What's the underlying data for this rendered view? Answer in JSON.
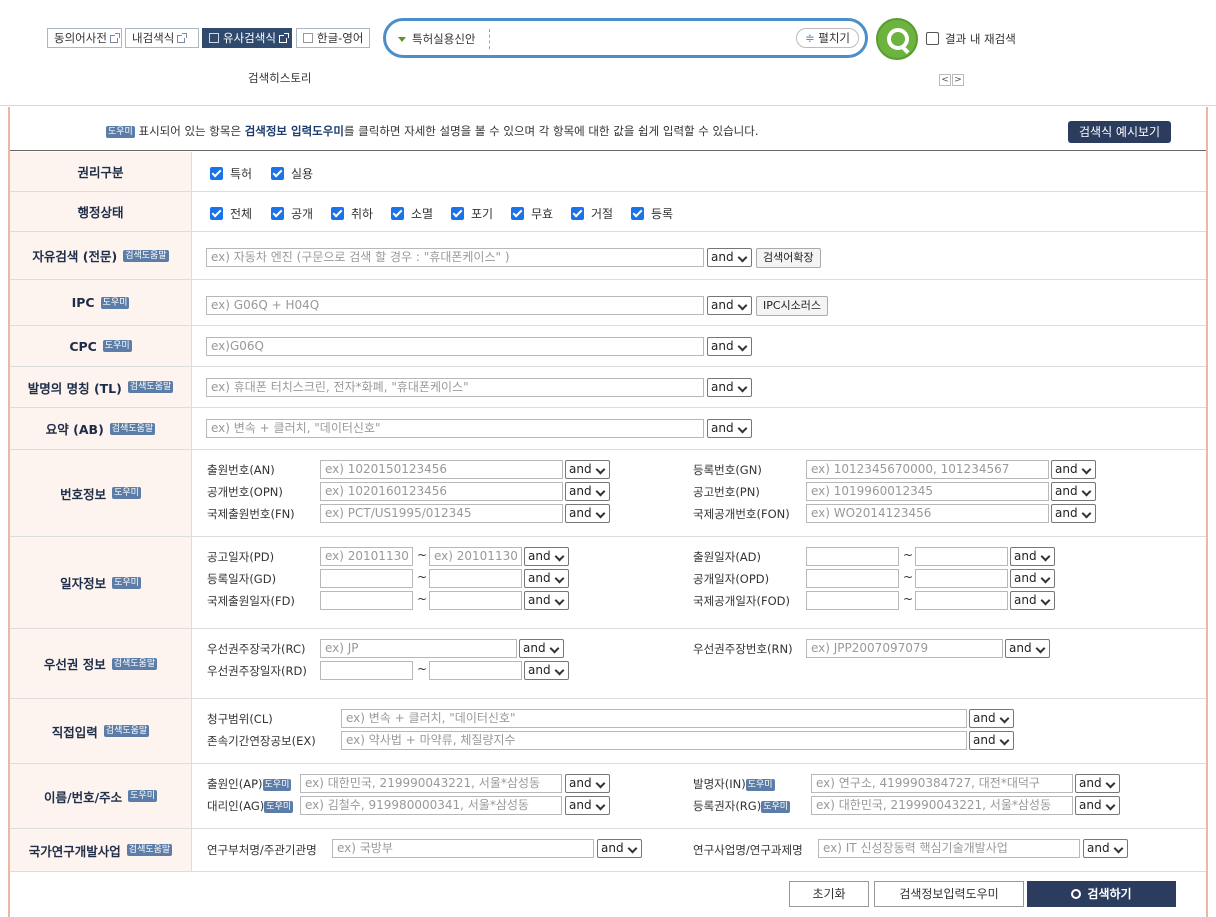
{
  "topbar": {
    "quick_buttons": [
      "동의어사전",
      "내검색식",
      "유사검색식",
      "한글-영어"
    ],
    "search_type": "특허실용신안",
    "expand_label": "펼치기",
    "research_label": "결과 내 재검색",
    "history_label": "검색히스토리"
  },
  "notice": {
    "help_badge": "도우미",
    "text_pre": " 표시되어 있는 항목은 ",
    "text_bold": "검색정보 입력도우미",
    "text_post": "를 클릭하면 자세한 설명을 볼 수 있으며 각 항목에 대한 값을 쉽게 입력할 수 있습니다.",
    "sample_button": "검색식 예시보기"
  },
  "help_badge": "도우미",
  "helper_badge": "검색도움말",
  "op": "and",
  "rights": {
    "label": "권리구분",
    "options": [
      "특허",
      "실용"
    ]
  },
  "status": {
    "label": "행정상태",
    "options": [
      "전체",
      "공개",
      "취하",
      "소멸",
      "포기",
      "무효",
      "거절",
      "등록"
    ]
  },
  "free": {
    "label": "자유검색 (전문)",
    "placeholder": "ex) 자동차 엔진  (구문으로 검색 할 경우 : \"휴대폰케이스\" )",
    "button": "검색어확장"
  },
  "ipc": {
    "label": "IPC",
    "placeholder": "ex) G06Q + H04Q",
    "button": "IPC시소러스"
  },
  "cpc": {
    "label": "CPC",
    "placeholder": "ex)G06Q"
  },
  "title": {
    "label": "발명의 명칭 (TL)",
    "placeholder": "ex) 휴대폰 터치스크린, 전자*화폐, \"휴대폰케이스\""
  },
  "abstract": {
    "label": "요약 (AB)",
    "placeholder": "ex) 변속 + 클러치, \"데이터신호\""
  },
  "numbers": {
    "label": "번호정보",
    "fields": [
      {
        "name": "출원번호(AN)",
        "placeholder": "ex) 1020150123456"
      },
      {
        "name": "공개번호(OPN)",
        "placeholder": "ex) 1020160123456"
      },
      {
        "name": "국제출원번호(FN)",
        "placeholder": "ex) PCT/US1995/012345"
      },
      {
        "name": "등록번호(GN)",
        "placeholder": "ex) 1012345670000, 101234567"
      },
      {
        "name": "공고번호(PN)",
        "placeholder": "ex) 1019960012345"
      },
      {
        "name": "국제공개번호(FON)",
        "placeholder": "ex) WO2014123456"
      }
    ]
  },
  "dates": {
    "label": "일자정보",
    "fields": [
      {
        "name": "공고일자(PD)",
        "from": "ex) 20101130",
        "to": "ex) 20101130"
      },
      {
        "name": "등록일자(GD)",
        "from": "",
        "to": ""
      },
      {
        "name": "국제출원일자(FD)",
        "from": "",
        "to": ""
      },
      {
        "name": "출원일자(AD)",
        "from": "",
        "to": ""
      },
      {
        "name": "공개일자(OPD)",
        "from": "",
        "to": ""
      },
      {
        "name": "국제공개일자(FOD)",
        "from": "",
        "to": ""
      }
    ]
  },
  "priority": {
    "label": "우선권 정보",
    "country": {
      "name": "우선권주장국가(RC)",
      "placeholder": "ex) JP"
    },
    "date": {
      "name": "우선권주장일자(RD)"
    },
    "number": {
      "name": "우선권주장번호(RN)",
      "placeholder": "ex) JPP2007097079"
    }
  },
  "direct": {
    "label": "직접입력",
    "claims": {
      "name": "청구범위(CL)",
      "placeholder": "ex) 변속 + 클러치, \"데이터신호\""
    },
    "extension": {
      "name": "존속기간연장공보(EX)",
      "placeholder": "ex) 약사법 + 마약류, 체질량지수"
    }
  },
  "names": {
    "label": "이름/번호/주소",
    "fields": [
      {
        "name": "출원인(AP)",
        "placeholder": "ex) 대한민국, 219990043221, 서울*삼성동"
      },
      {
        "name": "대리인(AG)",
        "placeholder": "ex) 김철수, 919980000341, 서울*삼성동"
      },
      {
        "name": "발명자(IN)",
        "placeholder": "ex) 연구소, 419990384727, 대전*대덕구"
      },
      {
        "name": "등록권자(RG)",
        "placeholder": "ex) 대한민국, 219990043221, 서울*삼성동"
      }
    ]
  },
  "national": {
    "label": "국가연구개발사업",
    "ministry": {
      "name": "연구부처명/주관기관명",
      "placeholder": "ex) 국방부"
    },
    "project": {
      "name": "연구사업명/연구과제명",
      "placeholder": "ex) IT 신성장동력 핵심기술개발사업"
    }
  },
  "actions": {
    "reset": "초기화",
    "helper": "검색정보입력도우미",
    "search": "검색하기"
  }
}
